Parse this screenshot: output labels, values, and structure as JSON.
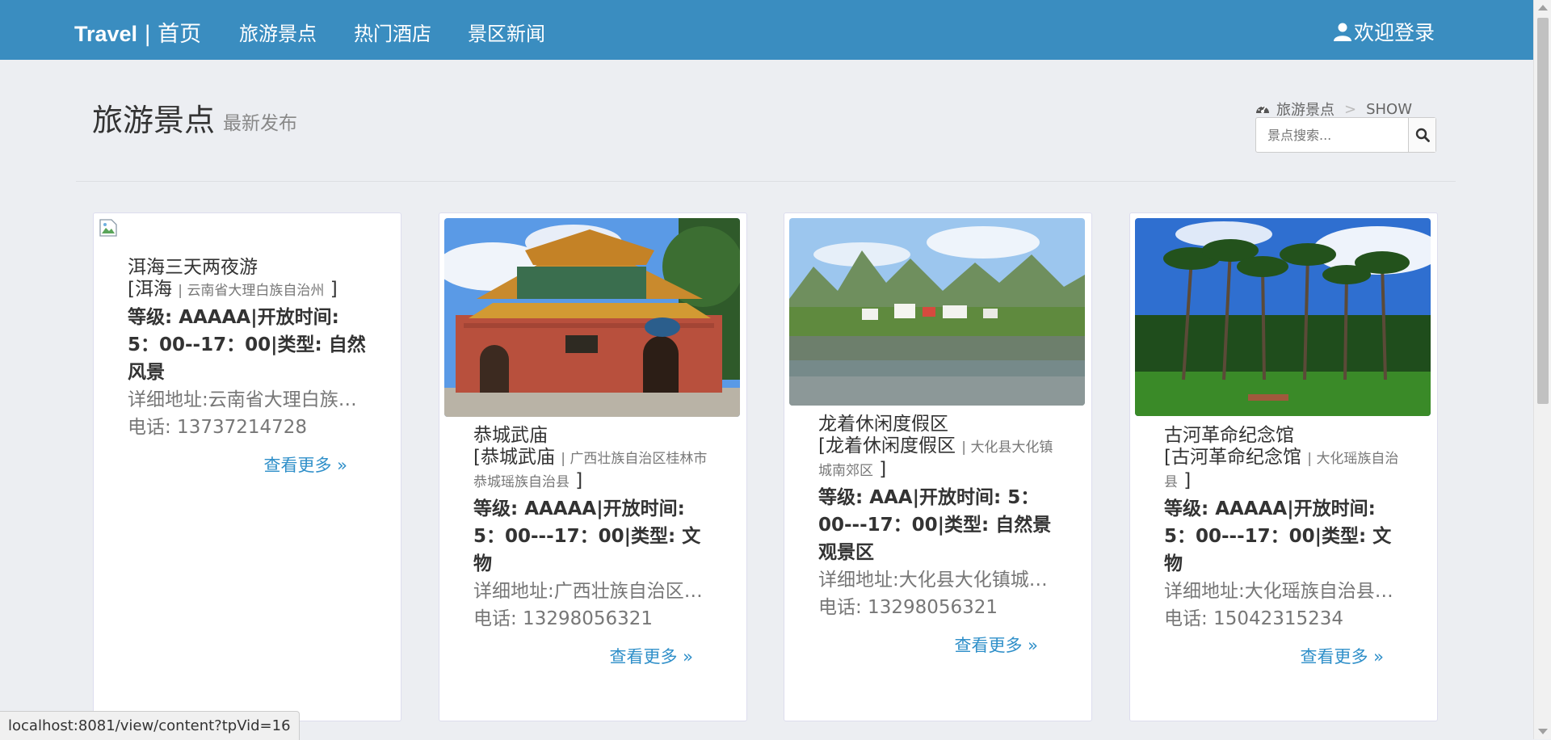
{
  "nav": {
    "brand": "Travel",
    "home": "首页",
    "links": [
      "旅游景点",
      "热门酒店",
      "景区新闻"
    ],
    "login": "欢迎登录"
  },
  "header": {
    "title": "旅游景点",
    "subtitle": "最新发布",
    "breadcrumb": [
      "旅游景点",
      "SHOW"
    ],
    "search_placeholder": "景点搜索..."
  },
  "cards": [
    {
      "name": "洱海三天两夜游",
      "loc_name": "[洱海",
      "loc_region": "云南省大理白族自治州",
      "info": "等级: AAAAA|开放时间: 5：00--17：00|类型: 自然风景",
      "address": "详细地址:云南省大理白族自治州",
      "phone": "电话: 13737214728",
      "more": "查看更多 »"
    },
    {
      "name": "恭城武庙",
      "loc_name": "[恭城武庙",
      "loc_region": "广西壮族自治区桂林市恭城瑶族自治县",
      "info": "等级: AAAAA|开放时间: 5：00---17：00|类型: 文物",
      "address": "详细地址:广西壮族自治区桂林市",
      "phone": "电话: 13298056321",
      "more": "查看更多 »"
    },
    {
      "name": "龙着休闲度假区",
      "loc_name": "[龙着休闲度假区",
      "loc_region": "大化县大化镇城南郊区",
      "info": "等级: AAA|开放时间: 5：00---17：00|类型: 自然景观景区",
      "address": "详细地址:大化县大化镇城南郊区",
      "phone": "电话: 13298056321",
      "more": "查看更多 »"
    },
    {
      "name": "古河革命纪念馆",
      "loc_name": "[古河革命纪念馆",
      "loc_region": "大化瑶族自治县",
      "info": "等级: AAAAA|开放时间: 5：00---17：00|类型: 文物",
      "address": "详细地址:大化瑶族自治县古河",
      "phone": "电话: 15042315234",
      "more": "查看更多 »"
    }
  ],
  "status_url": "localhost:8081/view/content?tpVid=16",
  "colors": {
    "navbar": "#3a8dc0",
    "link": "#2f8fc9",
    "background": "#eceef2"
  }
}
